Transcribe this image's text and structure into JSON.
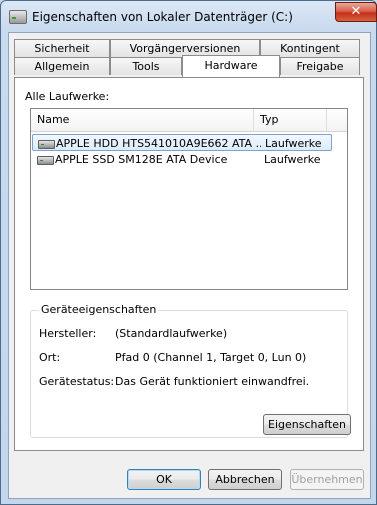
{
  "window": {
    "title": "Eigenschaften von Lokaler Datenträger (C:)",
    "close_label": "✕"
  },
  "tabs": {
    "row1": [
      "Sicherheit",
      "Vorgängerversionen",
      "Kontingent"
    ],
    "row2": [
      "Allgemein",
      "Tools",
      "Hardware",
      "Freigabe"
    ],
    "active": "Hardware"
  },
  "hardware": {
    "list_label": "Alle Laufwerke:",
    "columns": {
      "name": "Name",
      "type": "Typ"
    },
    "drives": [
      {
        "name": "APPLE HDD HTS541010A9E662 ATA ...",
        "type": "Laufwerke",
        "icon": "hard-drive-icon",
        "selected": true
      },
      {
        "name": "APPLE SSD SM128E ATA Device",
        "type": "Laufwerke",
        "icon": "hard-drive-icon",
        "selected": false
      }
    ],
    "group_title": "Geräteeigenschaften",
    "properties": {
      "manufacturer_label": "Hersteller:",
      "manufacturer_value": "(Standardlaufwerke)",
      "location_label": "Ort:",
      "location_value": "Pfad 0 (Channel 1, Target 0, Lun 0)",
      "status_label": "Gerätestatus:",
      "status_value": "Das Gerät funktioniert einwandfrei."
    },
    "properties_button": "Eigenschaften"
  },
  "buttons": {
    "ok": "OK",
    "cancel": "Abbrechen",
    "apply": "Übernehmen"
  }
}
